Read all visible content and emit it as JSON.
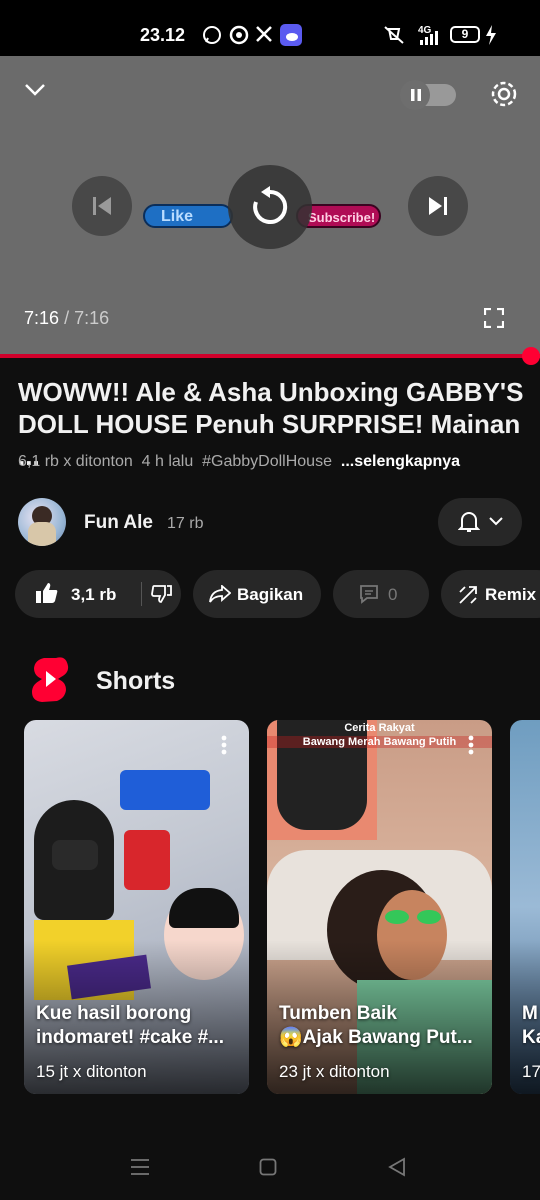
{
  "status_bar": {
    "time": "23.12",
    "network": "4G",
    "battery": "9"
  },
  "player": {
    "current_time": "7:16",
    "separator": "/",
    "duration": "7:16",
    "overlay_like_label": "Like",
    "overlay_subscribe_label": "Subscribe!",
    "progress": 1.0
  },
  "video": {
    "title": "WOWW!! Ale & Asha Unboxing GABBY'S DOLL HOUSE Penuh SURPRISE! Mainan ...",
    "title_line1": "WOWW!! Ale & Asha Unboxing GABBY'S",
    "title_line2": "DOLL HOUSE Penuh SURPRISE! Mainan ...",
    "views": "6,1 rb x ditonton",
    "age": "4 h lalu",
    "hashtag": "#GabbyDollHouse",
    "more": "...selengkapnya"
  },
  "channel": {
    "name": "Fun Ale",
    "subscribers": "17 rb"
  },
  "actions": {
    "likes": "3,1 rb",
    "share": "Bagikan",
    "comments": "0",
    "remix": "Remix"
  },
  "shorts": {
    "title": "Shorts",
    "items": [
      {
        "caption_line1": "Kue hasil borong",
        "caption_line2": "indomaret! #cake #...",
        "views": "15 jt x ditonton"
      },
      {
        "caption_line1": "Tumben Baik",
        "caption_line2": "😱Ajak Bawang Put...",
        "views": "23 jt x ditonton",
        "overlay_title": "Cerita Rakyat",
        "overlay_subtitle": "Bawang Merah Bawang Putih"
      },
      {
        "caption_line1": "M",
        "caption_line2": "Ka",
        "views": "17"
      }
    ]
  },
  "colors": {
    "accent": "#ff0033",
    "background": "#0f0f0f",
    "pill": "#272727"
  }
}
